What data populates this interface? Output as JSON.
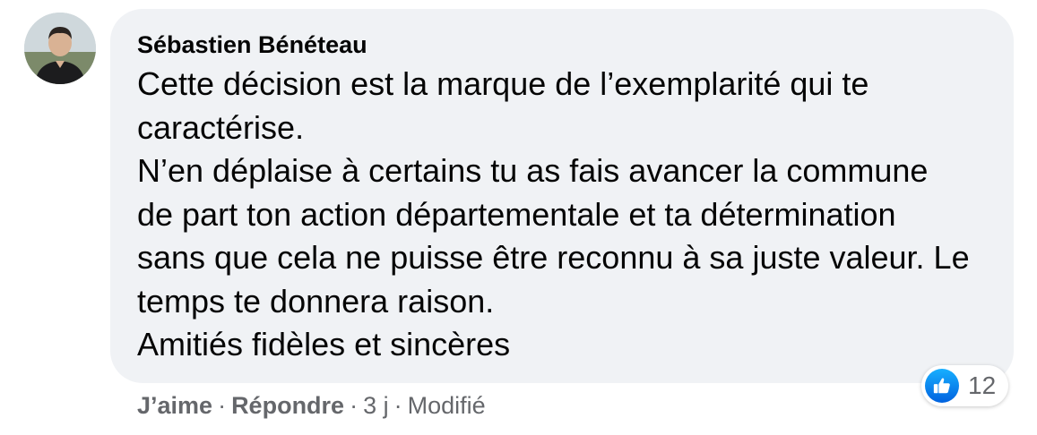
{
  "comment": {
    "author": "Sébastien Bénéteau",
    "lines": [
      "Cette décision est la marque de l’exemplarité qui te",
      "caractérise.",
      "N’en déplaise à certains tu as fais avancer la commune",
      "de part ton action départementale et ta détermination",
      "sans que cela ne puisse être reconnu à sa juste valeur. Le",
      "temps te donnera raison.",
      "Amitiés fidèles et sincères"
    ]
  },
  "reactions": {
    "icon": "like-icon",
    "count": "12",
    "color": "#1877f2"
  },
  "actions": {
    "like": "J’aime",
    "reply": "Répondre",
    "time": "3 j",
    "edited": "Modifié",
    "separator": "·"
  }
}
